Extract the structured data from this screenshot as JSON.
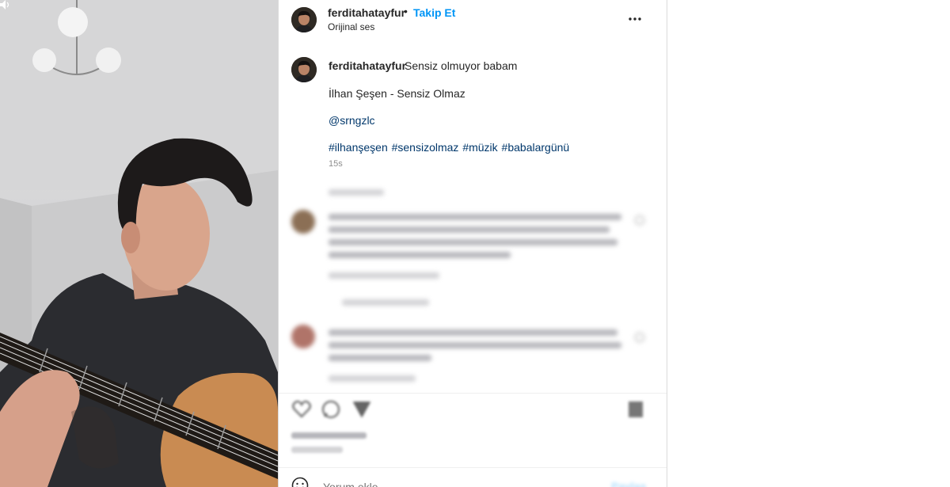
{
  "post": {
    "username": "ferditahatayfur",
    "separator": "•",
    "follow_label": "Takip Et",
    "audio_label": "Orijinal ses",
    "caption": {
      "username": "ferditahatayfur",
      "text": "Sensiz olmuyor babam",
      "song": "İlhan Şeşen - Sensiz Olmaz",
      "mention": "@srngzlc",
      "hashtags": "#ilhanşeşen #sensizolmaz #müzik #babalargünü",
      "time": "15s"
    },
    "comment_placeholder": "Yorum ekle...",
    "share_label": "Paylaş"
  },
  "icons": {
    "more": "more-options-icon",
    "like": "heart-icon",
    "comment": "comment-icon",
    "share": "send-icon",
    "save": "bookmark-icon",
    "emoji": "emoji-icon",
    "volume": "volume-icon"
  },
  "colors": {
    "follow": "#0095f6",
    "link": "#00376b",
    "text": "#262626",
    "muted": "#8e8e8e"
  }
}
